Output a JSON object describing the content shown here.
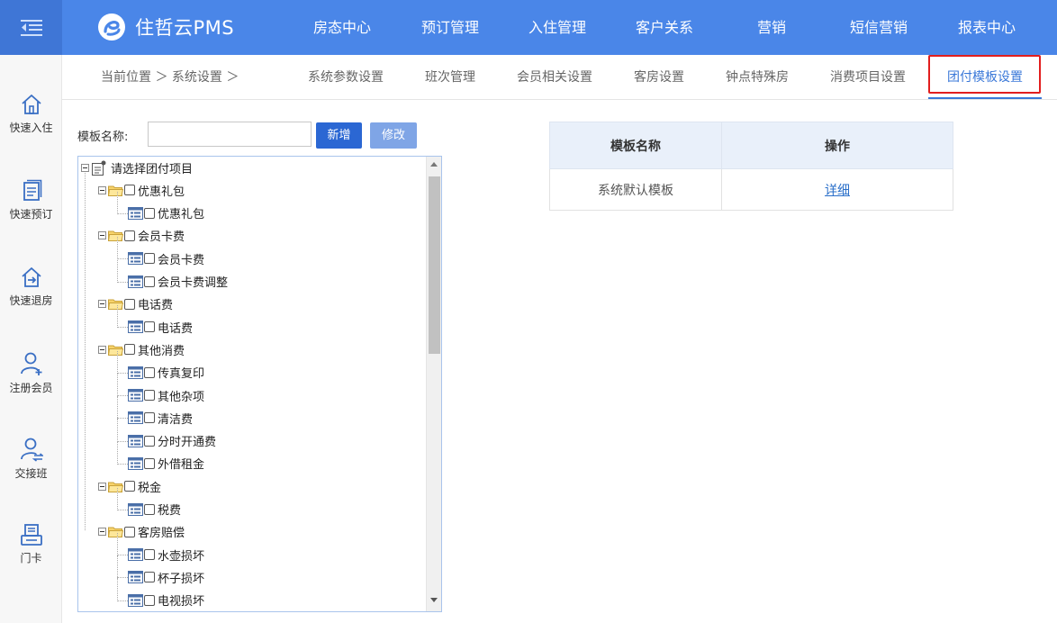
{
  "header": {
    "brand": "住哲云PMS",
    "nav": [
      {
        "label": "房态中心"
      },
      {
        "label": "预订管理"
      },
      {
        "label": "入住管理"
      },
      {
        "label": "客户关系"
      },
      {
        "label": "营销"
      },
      {
        "label": "短信营销"
      },
      {
        "label": "报表中心"
      }
    ]
  },
  "sidebar": {
    "items": [
      {
        "label": "快速入住",
        "icon": "home-icon"
      },
      {
        "label": "快速预订",
        "icon": "document-icon"
      },
      {
        "label": "快速退房",
        "icon": "checkout-icon"
      },
      {
        "label": "注册会员",
        "icon": "user-add-icon"
      },
      {
        "label": "交接班",
        "icon": "user-swap-icon"
      },
      {
        "label": "门卡",
        "icon": "card-printer-icon"
      }
    ]
  },
  "breadcrumb": {
    "text": "当前位置 ＞ 系统设置 ＞"
  },
  "tabs": [
    {
      "label": "系统参数设置",
      "active": false
    },
    {
      "label": "班次管理",
      "active": false
    },
    {
      "label": "会员相关设置",
      "active": false
    },
    {
      "label": "客房设置",
      "active": false
    },
    {
      "label": "钟点特殊房",
      "active": false
    },
    {
      "label": "消费项目设置",
      "active": false
    },
    {
      "label": "团付模板设置",
      "active": true
    }
  ],
  "form": {
    "name_label": "模板名称:",
    "name_value": "",
    "add_label": "新增",
    "edit_label": "修改"
  },
  "tree": {
    "root": "请选择团付项目",
    "nodes": [
      {
        "type": "group",
        "label": "优惠礼包"
      },
      {
        "type": "leaf",
        "label": "优惠礼包"
      },
      {
        "type": "group",
        "label": "会员卡费"
      },
      {
        "type": "leaf",
        "label": "会员卡费"
      },
      {
        "type": "leaf",
        "label": "会员卡费调整"
      },
      {
        "type": "group",
        "label": "电话费"
      },
      {
        "type": "leaf",
        "label": "电话费"
      },
      {
        "type": "group",
        "label": "其他消费"
      },
      {
        "type": "leaf",
        "label": "传真复印"
      },
      {
        "type": "leaf",
        "label": "其他杂项"
      },
      {
        "type": "leaf",
        "label": "清洁费"
      },
      {
        "type": "leaf",
        "label": "分时开通费"
      },
      {
        "type": "leaf",
        "label": "外借租金"
      },
      {
        "type": "group",
        "label": "税金"
      },
      {
        "type": "leaf",
        "label": "税费"
      },
      {
        "type": "group",
        "label": "客房赔偿"
      },
      {
        "type": "leaf",
        "label": "水壶损坏"
      },
      {
        "type": "leaf",
        "label": "杯子损坏"
      },
      {
        "type": "leaf",
        "label": "电视损坏"
      }
    ]
  },
  "template_table": {
    "headers": [
      "模板名称",
      "操作"
    ],
    "rows": [
      {
        "name": "系统默认模板",
        "action": "详细"
      }
    ]
  },
  "colors": {
    "header_bg": "#4a86e8",
    "accent": "#3a78d8",
    "highlight_border": "#e21e1e"
  }
}
